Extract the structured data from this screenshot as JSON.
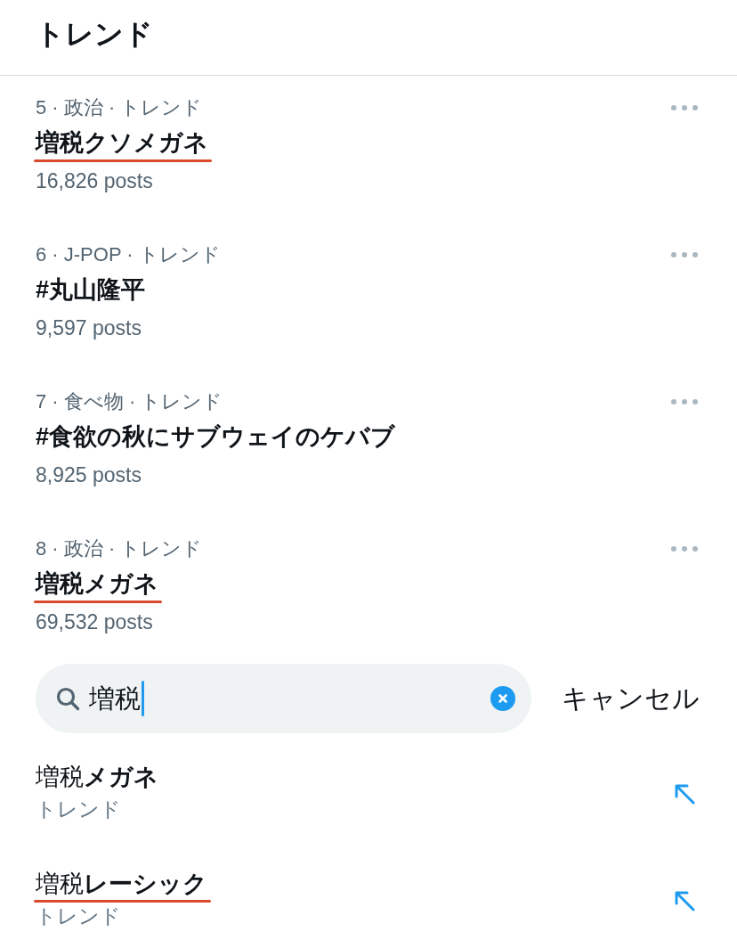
{
  "header": {
    "title": "トレンド"
  },
  "trends": [
    {
      "meta": "5 · 政治 · トレンド",
      "title": "増税クソメガネ",
      "posts": "16,826 posts",
      "underlined": true
    },
    {
      "meta": "6 · J-POP · トレンド",
      "title": "#丸山隆平",
      "posts": "9,597 posts",
      "underlined": false
    },
    {
      "meta": "7 · 食べ物 · トレンド",
      "title": "#食欲の秋にサブウェイのケバブ",
      "posts": "8,925 posts",
      "underlined": false
    },
    {
      "meta": "8 · 政治 · トレンド",
      "title": "増税メガネ",
      "posts": "69,532 posts",
      "underlined": true
    }
  ],
  "search": {
    "value": "増税",
    "focused": true,
    "cancel": "キャンセル"
  },
  "suggestions": [
    {
      "text": "増税**メガネ**",
      "subtitle": "トレンド",
      "underlined": false
    },
    {
      "text": "増税**レーシック**",
      "subtitle": "トレンド",
      "underlined": true
    }
  ]
}
